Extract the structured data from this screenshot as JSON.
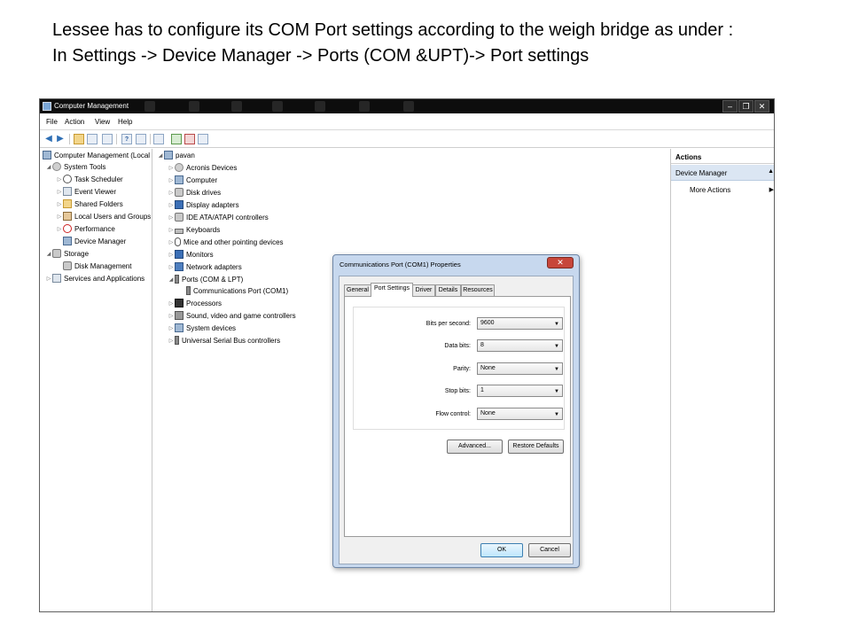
{
  "caption": {
    "line1": "Lessee has to configure its COM Port settings according to the weigh bridge as under :",
    "line2": "In Settings -> Device Manager -> Ports (COM &UPT)-> Port settings"
  },
  "window": {
    "title": "Computer Management",
    "controls": {
      "minimize": "–",
      "restore": "❐",
      "close": "✕"
    },
    "menu": [
      "File",
      "Action",
      "View",
      "Help"
    ]
  },
  "toolbar": {
    "icons": [
      "back-arrow-icon",
      "forward-arrow-icon",
      "up-folder-icon",
      "show-hide-tree-icon",
      "properties-icon",
      "help-icon",
      "show-hide-action-pane-icon",
      "scan-hardware-icon",
      "update-driver-icon",
      "uninstall-icon",
      "disable-device-icon"
    ],
    "help_glyph": "?"
  },
  "left_tree": [
    {
      "label": "Computer Management (Local",
      "level": 0,
      "arrow": "",
      "icon": "computer-management-icon"
    },
    {
      "label": "System Tools",
      "level": 1,
      "arrow": "◢",
      "icon": "system-tools-icon"
    },
    {
      "label": "Task Scheduler",
      "level": 2,
      "arrow": "▷",
      "icon": "task-scheduler-icon"
    },
    {
      "label": "Event Viewer",
      "level": 2,
      "arrow": "▷",
      "icon": "event-viewer-icon"
    },
    {
      "label": "Shared Folders",
      "level": 2,
      "arrow": "▷",
      "icon": "shared-folders-icon"
    },
    {
      "label": "Local Users and Groups",
      "level": 2,
      "arrow": "▷",
      "icon": "local-users-icon"
    },
    {
      "label": "Performance",
      "level": 2,
      "arrow": "▷",
      "icon": "performance-icon"
    },
    {
      "label": "Device Manager",
      "level": 2,
      "arrow": "",
      "icon": "device-manager-icon"
    },
    {
      "label": "Storage",
      "level": 1,
      "arrow": "◢",
      "icon": "storage-icon"
    },
    {
      "label": "Disk Management",
      "level": 2,
      "arrow": "",
      "icon": "disk-management-icon"
    },
    {
      "label": "Services and Applications",
      "level": 1,
      "arrow": "▷",
      "icon": "services-icon"
    }
  ],
  "device_tree": [
    {
      "label": "pavan",
      "level": 0,
      "arrow": "◢",
      "icon": "computer-icon"
    },
    {
      "label": "Acronis Devices",
      "level": 1,
      "arrow": "▷",
      "icon": "acronis-icon"
    },
    {
      "label": "Computer",
      "level": 1,
      "arrow": "▷",
      "icon": "computer-icon"
    },
    {
      "label": "Disk drives",
      "level": 1,
      "arrow": "▷",
      "icon": "disk-drive-icon"
    },
    {
      "label": "Display adapters",
      "level": 1,
      "arrow": "▷",
      "icon": "display-adapter-icon"
    },
    {
      "label": "IDE ATA/ATAPI controllers",
      "level": 1,
      "arrow": "▷",
      "icon": "ide-controller-icon"
    },
    {
      "label": "Keyboards",
      "level": 1,
      "arrow": "▷",
      "icon": "keyboard-icon"
    },
    {
      "label": "Mice and other pointing devices",
      "level": 1,
      "arrow": "▷",
      "icon": "mouse-icon"
    },
    {
      "label": "Monitors",
      "level": 1,
      "arrow": "▷",
      "icon": "monitor-icon"
    },
    {
      "label": "Network adapters",
      "level": 1,
      "arrow": "▷",
      "icon": "network-adapter-icon"
    },
    {
      "label": "Ports (COM & LPT)",
      "level": 1,
      "arrow": "◢",
      "icon": "port-icon"
    },
    {
      "label": "Communications Port (COM1)",
      "level": 2,
      "arrow": "",
      "icon": "port-icon"
    },
    {
      "label": "Processors",
      "level": 1,
      "arrow": "▷",
      "icon": "processor-icon"
    },
    {
      "label": "Sound, video and game controllers",
      "level": 1,
      "arrow": "▷",
      "icon": "sound-icon"
    },
    {
      "label": "System devices",
      "level": 1,
      "arrow": "▷",
      "icon": "system-devices-icon"
    },
    {
      "label": "Universal Serial Bus controllers",
      "level": 1,
      "arrow": "▷",
      "icon": "usb-icon"
    }
  ],
  "actions": {
    "header": "Actions",
    "section": "Device Manager",
    "collapse_glyph": "▲",
    "more": "More Actions",
    "more_glyph": "▶"
  },
  "dialog": {
    "title": "Communications Port (COM1) Properties",
    "close": "✕",
    "tabs": [
      "General",
      "Port Settings",
      "Driver",
      "Details",
      "Resources"
    ],
    "active_tab": "Port Settings",
    "fields": [
      {
        "label": "Bits per second:",
        "value": "9600"
      },
      {
        "label": "Data bits:",
        "value": "8"
      },
      {
        "label": "Parity:",
        "value": "None"
      },
      {
        "label": "Stop bits:",
        "value": "1"
      },
      {
        "label": "Flow control:",
        "value": "None"
      }
    ],
    "dropdown_glyph": "▼",
    "advanced": "Advanced...",
    "restore": "Restore Defaults",
    "ok": "OK",
    "cancel": "Cancel"
  }
}
